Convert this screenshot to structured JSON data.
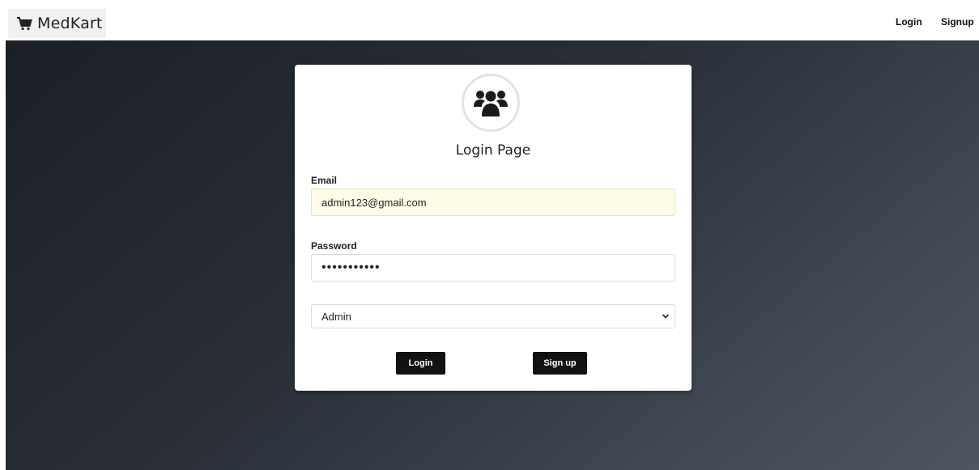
{
  "navbar": {
    "brand": "MedKart",
    "brand_icon": "cart-icon",
    "links": [
      {
        "label": "Login"
      },
      {
        "label": "Signup"
      }
    ]
  },
  "login_card": {
    "avatar_icon": "users-group-icon",
    "title": "Login Page",
    "email": {
      "label": "Email",
      "value": "admin123@gmail.com"
    },
    "password": {
      "label": "Password",
      "value": "•••••••••••"
    },
    "role_select": {
      "selected": "Admin"
    },
    "buttons": {
      "login": "Login",
      "signup": "Sign up"
    }
  },
  "colors": {
    "hero_dark": "#1b1f26",
    "hero_light": "#4d5661",
    "button_bg": "#111111",
    "email_autofill_bg": "#fefce6"
  }
}
